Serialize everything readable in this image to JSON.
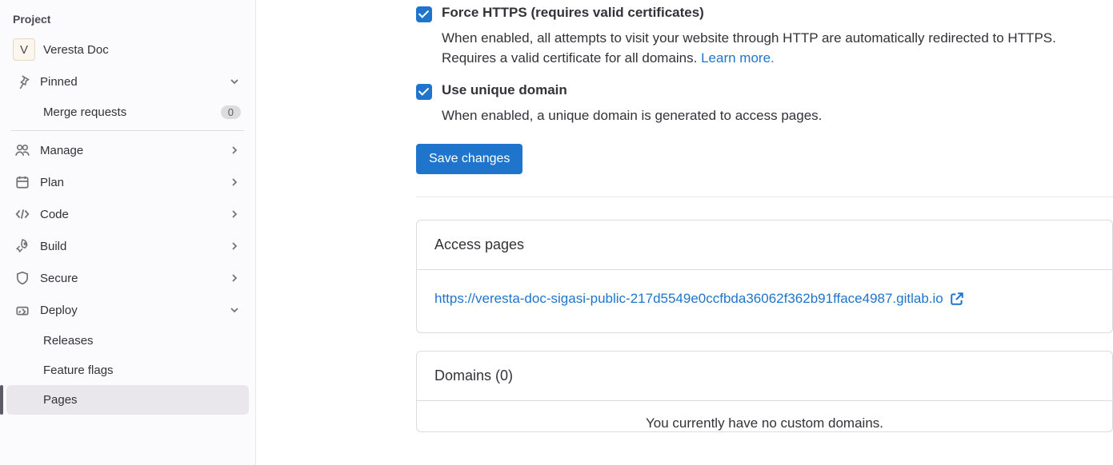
{
  "sidebar": {
    "heading": "Project",
    "project": {
      "initial": "V",
      "name": "Veresta Doc"
    },
    "pinned_label": "Pinned",
    "merge_requests": {
      "label": "Merge requests",
      "count": "0"
    },
    "items": {
      "manage": "Manage",
      "plan": "Plan",
      "code": "Code",
      "build": "Build",
      "secure": "Secure",
      "deploy": "Deploy"
    },
    "deploy_children": {
      "releases": "Releases",
      "feature_flags": "Feature flags",
      "pages": "Pages"
    }
  },
  "settings": {
    "force_https": {
      "title": "Force HTTPS (requires valid certificates)",
      "description_prefix": "When enabled, all attempts to visit your website through HTTP are automatically redirected to HTTPS. Requires a valid certificate for all domains. ",
      "learn_more": "Learn more."
    },
    "unique_domain": {
      "title": "Use unique domain",
      "description": "When enabled, a unique domain is generated to access pages."
    },
    "save_button": "Save changes"
  },
  "access_pages": {
    "heading": "Access pages",
    "url": "https://veresta-doc-sigasi-public-217d5549e0ccfbda36062f362b91fface4987.gitlab.io"
  },
  "domains": {
    "heading": "Domains (0)",
    "empty_text": "You currently have no custom domains."
  }
}
